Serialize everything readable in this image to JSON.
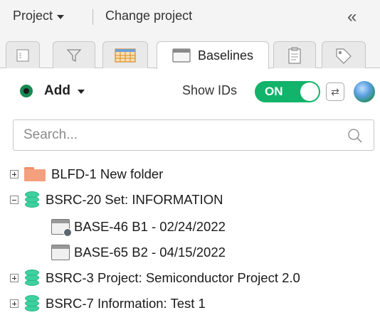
{
  "header": {
    "project_label": "Project",
    "change_project_label": "Change project",
    "collapse_glyph": "«"
  },
  "tabs": [
    {
      "icon": "document-view-icon"
    },
    {
      "icon": "filter-icon"
    },
    {
      "icon": "grid-table-icon"
    },
    {
      "icon": "baseline-calendar-icon",
      "label": "Baselines",
      "active": true
    },
    {
      "icon": "clipboard-icon"
    },
    {
      "icon": "tag-icon"
    }
  ],
  "toolbar": {
    "add_label": "Add",
    "show_ids_label": "Show IDs",
    "toggle_state": "ON",
    "toggle_color": "#12b36a"
  },
  "search": {
    "placeholder": "Search..."
  },
  "tree": [
    {
      "label": "BLFD-1 New folder",
      "icon": "folder-icon",
      "expander": "plus",
      "level": 0
    },
    {
      "label": "BSRC-20 Set: INFORMATION",
      "icon": "database-icon",
      "expander": "minus",
      "level": 0
    },
    {
      "label": "BASE-46 B1 - 02/24/2022",
      "icon": "baseline-with-badge-icon",
      "level": 1
    },
    {
      "label": "BASE-65 B2 - 04/15/2022",
      "icon": "baseline-icon",
      "level": 1
    },
    {
      "label": "BSRC-3 Project: Semiconductor Project 2.0",
      "icon": "database-icon",
      "expander": "plus",
      "level": 0
    },
    {
      "label": "BSRC-7 Information: Test 1",
      "icon": "database-icon",
      "expander": "plus",
      "level": 0
    }
  ]
}
